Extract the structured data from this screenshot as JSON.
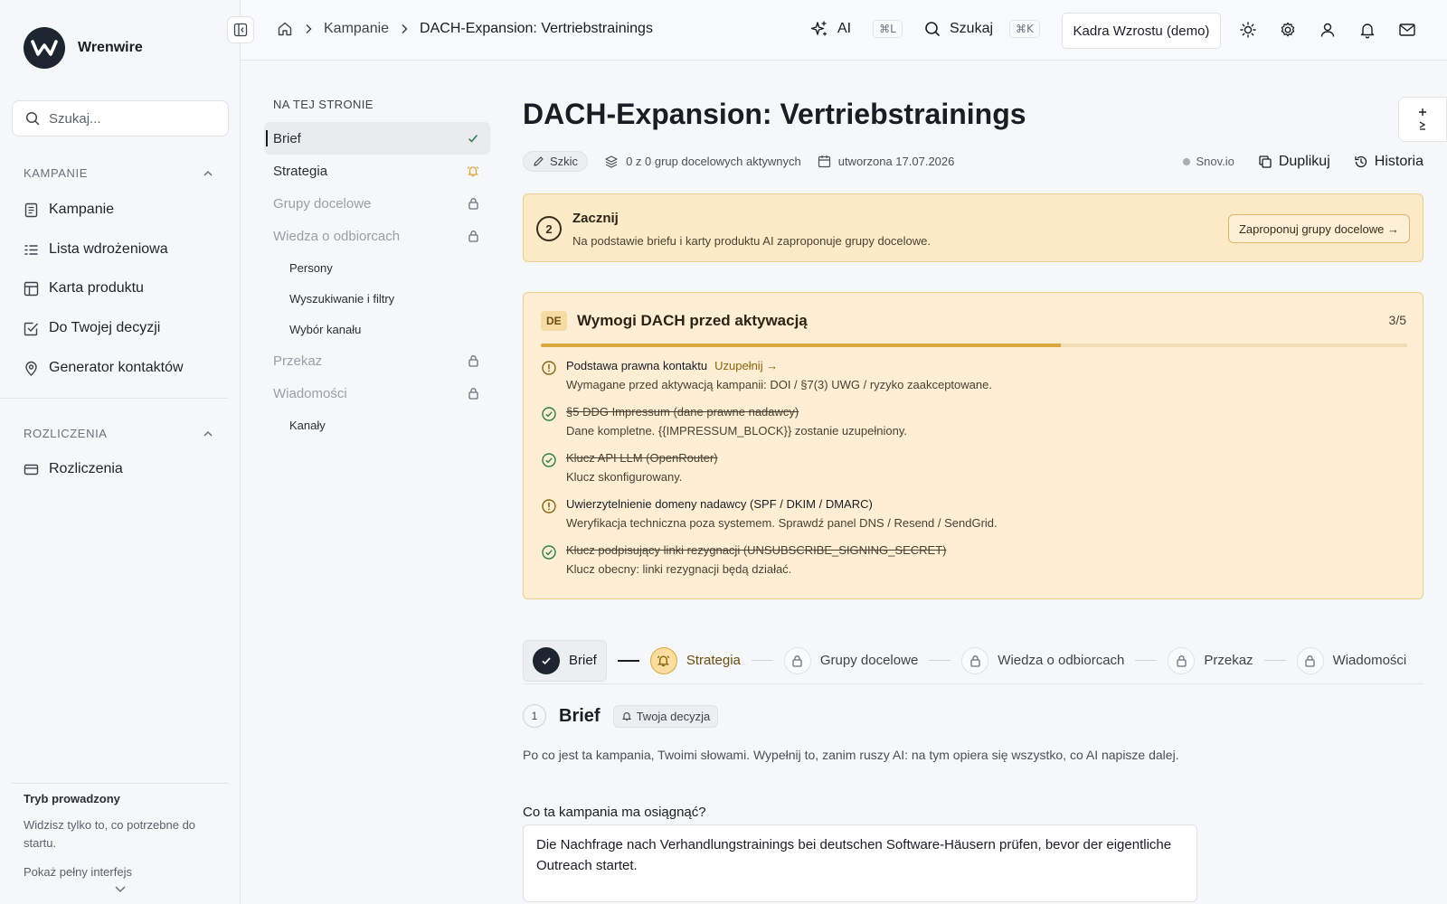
{
  "sidebar": {
    "brand": "Wrenwire",
    "search_placeholder": "Szukaj...",
    "sections": [
      {
        "title": "KAMPANIE",
        "items": [
          {
            "label": "Kampanie",
            "icon": "list-doc-icon"
          },
          {
            "label": "Lista wdrożeniowa",
            "icon": "checklist-icon"
          },
          {
            "label": "Karta produktu",
            "icon": "layout-icon"
          },
          {
            "label": "Do Twojej decyzji",
            "icon": "checkbox-icon"
          },
          {
            "label": "Generator kontaktów",
            "icon": "map-pin-icon"
          }
        ]
      },
      {
        "title": "ROZLICZENIA",
        "items": [
          {
            "label": "Rozliczenia",
            "icon": "credit-card-icon"
          }
        ]
      }
    ],
    "guided": {
      "title": "Tryb prowadzony",
      "desc": "Widzisz tylko to, co potrzebne do startu.",
      "link": "Pokaż pełny interfejs"
    }
  },
  "topbar": {
    "breadcrumb": [
      "Kampanie",
      "DACH-Expansion: Vertriebstrainings"
    ],
    "ai_label": "AI",
    "ai_shortcut": "⌘L",
    "search_label": "Szukaj",
    "search_shortcut": "⌘K",
    "workspace": "Kadra Wzrostu (demo)"
  },
  "onpage": {
    "title": "NA TEJ STRONIE",
    "items": [
      {
        "label": "Brief",
        "state": "done"
      },
      {
        "label": "Strategia",
        "state": "warn"
      },
      {
        "label": "Grupy docelowe",
        "state": "locked"
      },
      {
        "label": "Wiedza o odbiorcach",
        "state": "locked"
      }
    ],
    "sub1": [
      "Persony",
      "Wyszukiwanie i filtry",
      "Wybór kanału"
    ],
    "items2": [
      {
        "label": "Przekaz",
        "state": "locked"
      },
      {
        "label": "Wiadomości",
        "state": "locked"
      }
    ],
    "sub2": [
      "Kanały"
    ]
  },
  "campaign": {
    "title": "DACH-Expansion: Vertriebstrainings",
    "status": "Szkic",
    "groups_active": "0 z 0 grup docelowych aktywnych",
    "created": "utworzona 17.07.2026",
    "provider": "Snov.io",
    "duplicate": "Duplikuj",
    "history": "Historia"
  },
  "start": {
    "number": "2",
    "title": "Zacznij",
    "desc": "Na podstawie briefu i karty produktu AI zaproponuje grupy docelowe.",
    "button": "Zaproponuj grupy docelowe →"
  },
  "requirements": {
    "badge": "DE",
    "title": "Wymogi DACH przed aktywacją",
    "count": "3/5",
    "progress": 0.6,
    "items": [
      {
        "title": "Podstawa prawna kontaktu",
        "fix": "Uzupełnij →",
        "sub": "Wymagane przed aktywacją kampanii: DOI / §7(3) UWG / ryzyko zaakceptowane.",
        "done": false
      },
      {
        "title": "§5 DDG Impressum (dane prawne nadawcy)",
        "fix": "",
        "sub": "Dane kompletne. {{IMPRESSUM_BLOCK}} zostanie uzupełniony.",
        "done": true
      },
      {
        "title": "Klucz API LLM (OpenRouter)",
        "fix": "",
        "sub": "Klucz skonfigurowany.",
        "done": true
      },
      {
        "title": "Uwierzytelnienie domeny nadawcy (SPF / DKIM / DMARC)",
        "fix": "",
        "sub": "Weryfikacja techniczna poza systemem. Sprawdź panel DNS / Resend / SendGrid.",
        "done": false
      },
      {
        "title": "Klucz podpisujący linki rezygnacji (UNSUBSCRIBE_SIGNING_SECRET)",
        "fix": "",
        "sub": "Klucz obecny: linki rezygnacji będą działać.",
        "done": true
      }
    ]
  },
  "stepper": {
    "steps": [
      {
        "label": "Brief",
        "state": "done"
      },
      {
        "label": "Strategia",
        "state": "warn"
      },
      {
        "label": "Grupy docelowe",
        "state": "locked"
      },
      {
        "label": "Wiedza o odbiorcach",
        "state": "locked"
      },
      {
        "label": "Przekaz",
        "state": "locked"
      },
      {
        "label": "Wiadomości",
        "state": "locked"
      }
    ]
  },
  "brief": {
    "number": "1",
    "title": "Brief",
    "chip": "Twoja decyzja",
    "desc": "Po co jest ta kampania, Twoimi słowami. Wypełnij to, zanim ruszy AI: na tym opiera się wszystko, co AI napisze dalej.",
    "question": "Co ta kampania ma osiągnąć?",
    "answer": "Die Nachfrage nach Verhandlungstrainings bei deutschen Software-Häusern prüfen, bevor der eigentliche Outreach startet."
  },
  "colors": {
    "accent_dark": "#1d2530",
    "warning_bg": "#fdebc8",
    "warning_border": "#efcf8f",
    "success": "#2f7d4a",
    "warning_icon": "#8a6410"
  }
}
